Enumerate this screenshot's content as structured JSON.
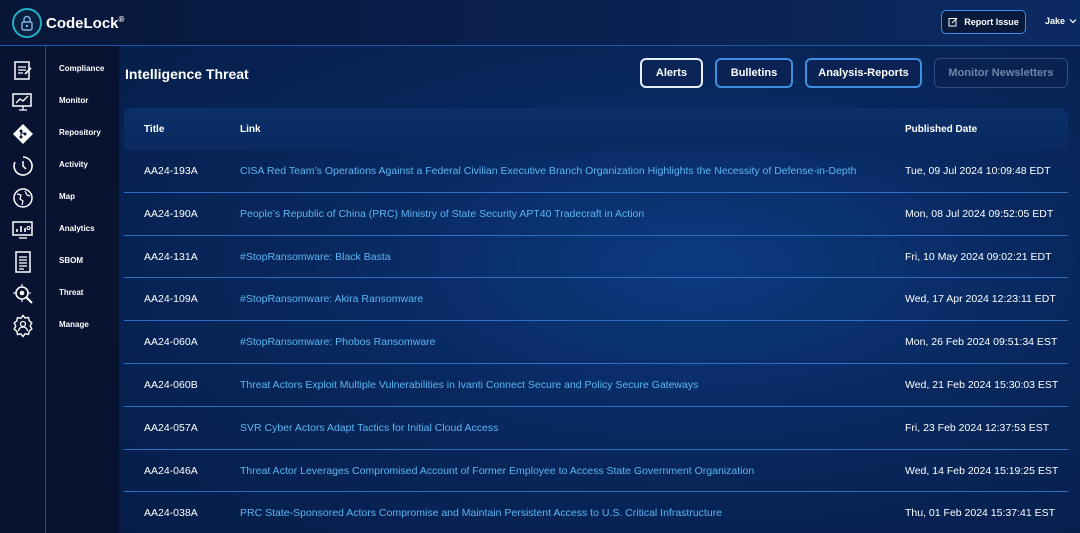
{
  "app": {
    "name": "CodeLock",
    "trademark": "®"
  },
  "header": {
    "report_label": "Report Issue",
    "user_name": "Jake"
  },
  "sidebar": {
    "items": [
      {
        "label": "Compliance",
        "icon": "compliance-icon"
      },
      {
        "label": "Monitor",
        "icon": "monitor-icon"
      },
      {
        "label": "Repository",
        "icon": "repository-icon"
      },
      {
        "label": "Activity",
        "icon": "activity-icon"
      },
      {
        "label": "Map",
        "icon": "map-icon"
      },
      {
        "label": "Analytics",
        "icon": "analytics-icon"
      },
      {
        "label": "SBOM",
        "icon": "sbom-icon"
      },
      {
        "label": "Threat",
        "icon": "threat-icon"
      },
      {
        "label": "Manage",
        "icon": "manage-icon"
      }
    ]
  },
  "main": {
    "title": "Intelligence Threat",
    "tabs": [
      {
        "label": "Alerts",
        "state": "selected"
      },
      {
        "label": "Bulletins",
        "state": "enabled"
      },
      {
        "label": "Analysis-Reports",
        "state": "enabled"
      },
      {
        "label": "Monitor Newsletters",
        "state": "disabled"
      }
    ],
    "table": {
      "headers": {
        "title": "Title",
        "link": "Link",
        "date": "Published Date"
      },
      "rows": [
        {
          "title": "AA24-193A",
          "link": "CISA Red Team’s Operations Against a Federal Civilian Executive Branch Organization Highlights the Necessity of Defense-in-Depth",
          "date": "Tue, 09 Jul 2024 10:09:48 EDT"
        },
        {
          "title": "AA24-190A",
          "link": "People’s Republic of China (PRC) Ministry of State Security APT40 Tradecraft in Action",
          "date": "Mon, 08 Jul 2024 09:52:05 EDT"
        },
        {
          "title": "AA24-131A",
          "link": "#StopRansomware: Black Basta",
          "date": "Fri, 10 May 2024 09:02:21 EDT"
        },
        {
          "title": "AA24-109A",
          "link": "#StopRansomware: Akira Ransomware",
          "date": "Wed, 17 Apr 2024 12:23:11 EDT"
        },
        {
          "title": "AA24-060A",
          "link": "#StopRansomware: Phobos Ransomware",
          "date": "Mon, 26 Feb 2024 09:51:34 EST"
        },
        {
          "title": "AA24-060B",
          "link": "Threat Actors Exploit Multiple Vulnerabilities in Ivanti Connect Secure and Policy Secure Gateways",
          "date": "Wed, 21 Feb 2024 15:30:03 EST"
        },
        {
          "title": "AA24-057A",
          "link": "SVR Cyber Actors Adapt Tactics for Initial Cloud Access",
          "date": "Fri, 23 Feb 2024 12:37:53 EST"
        },
        {
          "title": "AA24-046A",
          "link": "Threat Actor Leverages Compromised Account of Former Employee to Access State Government Organization",
          "date": "Wed, 14 Feb 2024 15:19:25 EST"
        },
        {
          "title": "AA24-038A",
          "link": "PRC State-Sponsored Actors Compromise and Maintain Persistent Access to U.S. Critical Infrastructure",
          "date": "Thu, 01 Feb 2024 15:37:41 EST"
        }
      ]
    }
  },
  "colors": {
    "accent": "#3f8fe0",
    "link": "#5ab6f4",
    "background": "#071535",
    "row_border": "#2e6fc4"
  }
}
